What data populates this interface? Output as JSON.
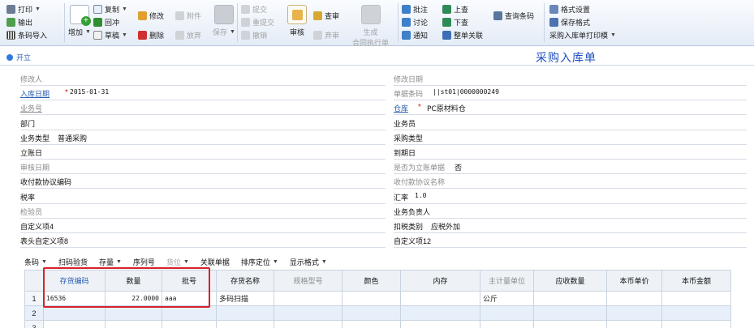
{
  "toolbar": {
    "print": "打印",
    "export": "输出",
    "barcode_import": "条码导入",
    "add": "增加",
    "copy": "复制",
    "reverse": "回冲",
    "draft": "草稿",
    "modify": "修改",
    "delete": "删除",
    "attachment": "附件",
    "abandon": "放弃",
    "save": "保存",
    "submit": "提交",
    "resubmit": "重提交",
    "withdraw": "撤销",
    "audit": "审核",
    "verify": "查审",
    "discard": "弃审",
    "generate_contract": "生成",
    "generate_contract_2": "合同执行单",
    "annotate": "批注",
    "discuss": "讨论",
    "notify": "通知",
    "prev": "上查",
    "next": "下查",
    "whole_link": "整单关联",
    "query_barcode": "查询条码",
    "format_settings": "格式设置",
    "save_format": "保存格式",
    "print_template": "采购入库单打印模"
  },
  "header": {
    "open": "开立",
    "title": "采购入库单"
  },
  "fields": {
    "modifier": "修改人",
    "modify_date": "修改日期",
    "in_date_label": "入库日期",
    "in_date_value": "2015-01-31",
    "doc_barcode_label": "单据条码",
    "doc_barcode_value": "||st01|0000000249",
    "business_no": "业务号",
    "warehouse_label": "仓库",
    "warehouse_value": "PC原材料仓",
    "department": "部门",
    "salesman": "业务员",
    "business_type_label": "业务类型",
    "business_type_value": "普通采购",
    "purchase_type": "采购类型",
    "account_date": "立账日",
    "due_date": "到期日",
    "audit_date": "审核日期",
    "is_account_doc_label": "是否为立账单据",
    "is_account_doc_value": "否",
    "payment_agreement_code": "收付款协议编码",
    "payment_agreement_name": "收付款协议名称",
    "tax_rate": "税率",
    "exchange_rate_label": "汇率",
    "exchange_rate_value": "1.0",
    "inspector": "检验员",
    "business_owner": "业务负责人",
    "custom_item4": "自定义项4",
    "tax_category_label": "扣税类别",
    "tax_category_value": "应税外加",
    "header_custom8": "表头自定义项8",
    "custom_item12": "自定义项12"
  },
  "grid_toolbar": {
    "barcode": "条码",
    "scan_check": "扫码验货",
    "stock": "存量",
    "serial": "序列号",
    "location": "货位",
    "related_docs": "关联单据",
    "sort_locate": "排序定位",
    "display_format": "显示格式"
  },
  "grid": {
    "columns": [
      "",
      "存货编码",
      "数量",
      "批号",
      "存货名称",
      "规格型号",
      "颜色",
      "内存",
      "主计量单位",
      "应收数量",
      "本币单价",
      "本币金额"
    ],
    "rows": [
      [
        "1",
        "16536",
        "22.0000",
        "aaa",
        "多码扫描",
        "",
        "",
        "",
        "公斤",
        "",
        "",
        ""
      ],
      [
        "2",
        "",
        "",
        "",
        "",
        "",
        "",
        "",
        "",
        "",
        "",
        ""
      ],
      [
        "3",
        "",
        "",
        "",
        "",
        "",
        "",
        "",
        "",
        "",
        "",
        ""
      ]
    ]
  },
  "colors": {
    "accent": "#2a5db0",
    "title": "#1f4fbf",
    "required": "#d01c1c",
    "highlight_box": "#d8202a"
  }
}
